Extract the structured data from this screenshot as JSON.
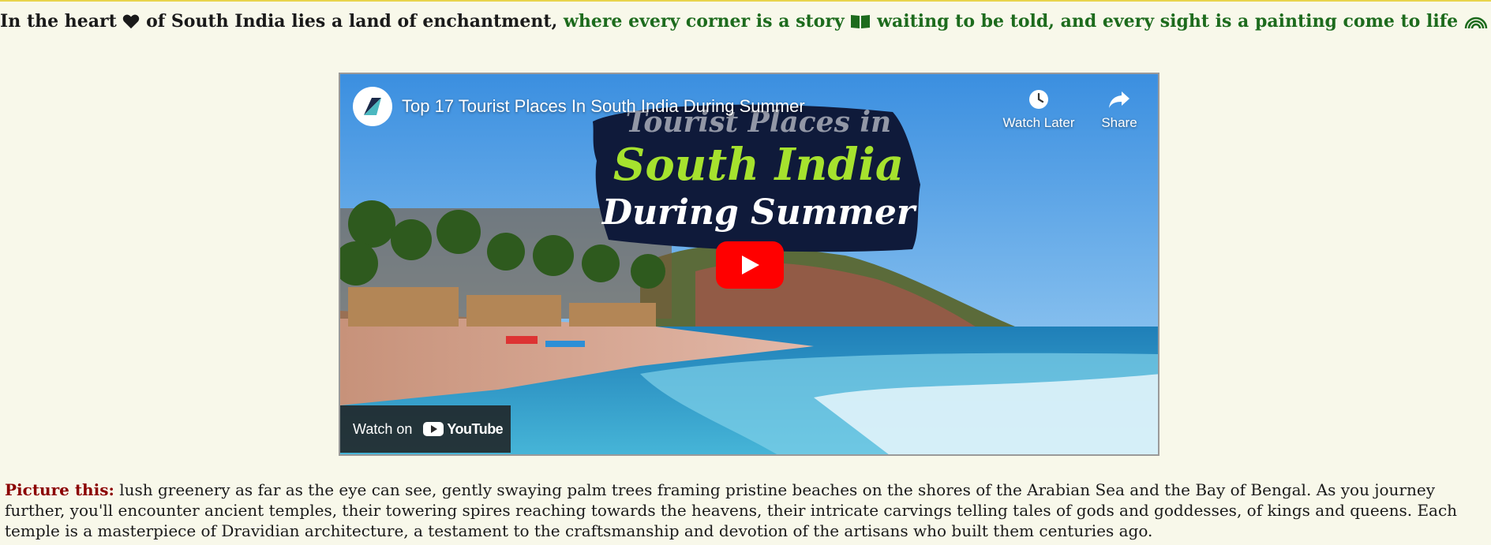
{
  "headline": {
    "part1": "In the heart",
    "part2": "of South India lies a land of enchantment,",
    "part3": "where every corner is a story",
    "part4": "waiting to be told, and every sight is a painting come to life",
    "part5": "."
  },
  "video": {
    "title": "Top 17 Tourist Places In South India During Summer",
    "watch_later_label": "Watch Later",
    "share_label": "Share",
    "watch_on_label": "Watch on",
    "youtube_label": "YouTube",
    "thumbnail_line1": "Tourist Places in",
    "thumbnail_line2": "South India",
    "thumbnail_line3": "During Summer"
  },
  "paragraph": {
    "lead": "Picture this:",
    "body": " lush greenery as far as the eye can see, gently swaying palm trees framing pristine beaches on the shores of the Arabian Sea and the Bay of Bengal. As you journey further, you'll encounter ancient temples, their towering spires reaching towards the heavens, their intricate carvings telling tales of gods and goddesses, of kings and queens. Each temple is a masterpiece of Dravidian architecture, a testament to the craftsmanship and devotion of the artisans who built them centuries ago."
  },
  "colors": {
    "background": "#f8f8ea",
    "green_text": "#1d6b1d",
    "lead_red": "#8b0000",
    "play_red": "#ff0000"
  },
  "icons": [
    "heart-icon",
    "book-icon",
    "rainbow-icon",
    "clock-icon",
    "share-icon",
    "play-icon",
    "youtube-icon"
  ]
}
